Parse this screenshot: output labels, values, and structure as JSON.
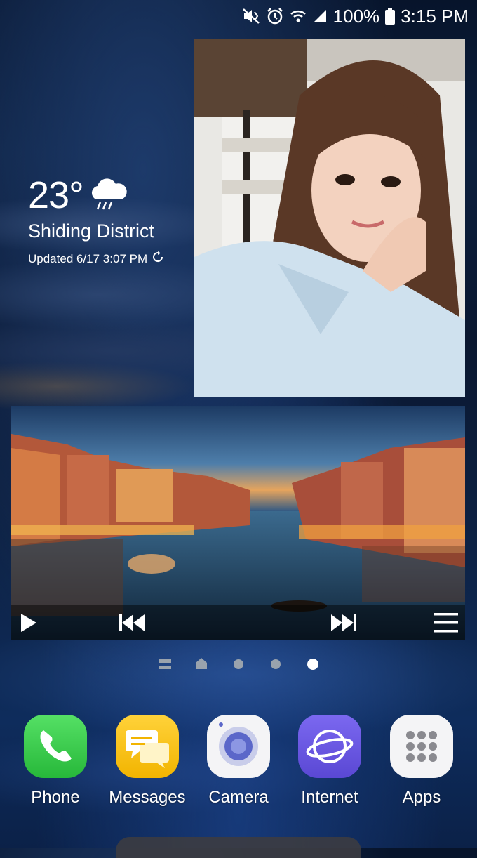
{
  "status_bar": {
    "battery": "100%",
    "time": "3:15 PM",
    "icons": [
      "mute-vibrate-icon",
      "alarm-icon",
      "wifi-icon",
      "signal-icon",
      "battery-icon"
    ]
  },
  "weather": {
    "temperature": "23°",
    "location": "Shiding District",
    "updated": "Updated 6/17  3:07 PM",
    "condition_icon": "rain-cloud-icon"
  },
  "video_widget": {
    "controls": [
      "play-icon",
      "previous-icon",
      "next-icon",
      "menu-icon"
    ]
  },
  "pager": {
    "pages": [
      "briefing",
      "home",
      "page-3",
      "page-4",
      "page-5"
    ],
    "active_index": 4
  },
  "dock": {
    "apps": [
      {
        "label": "Phone",
        "icon": "phone-icon",
        "color": "#3ccf4e"
      },
      {
        "label": "Messages",
        "icon": "messages-icon",
        "color": "#f5c21b"
      },
      {
        "label": "Camera",
        "icon": "camera-icon",
        "color": "#f2f2f4"
      },
      {
        "label": "Internet",
        "icon": "internet-icon",
        "color": "#6f5ce0"
      },
      {
        "label": "Apps",
        "icon": "apps-grid-icon",
        "color": "#f2f2f4"
      }
    ]
  }
}
